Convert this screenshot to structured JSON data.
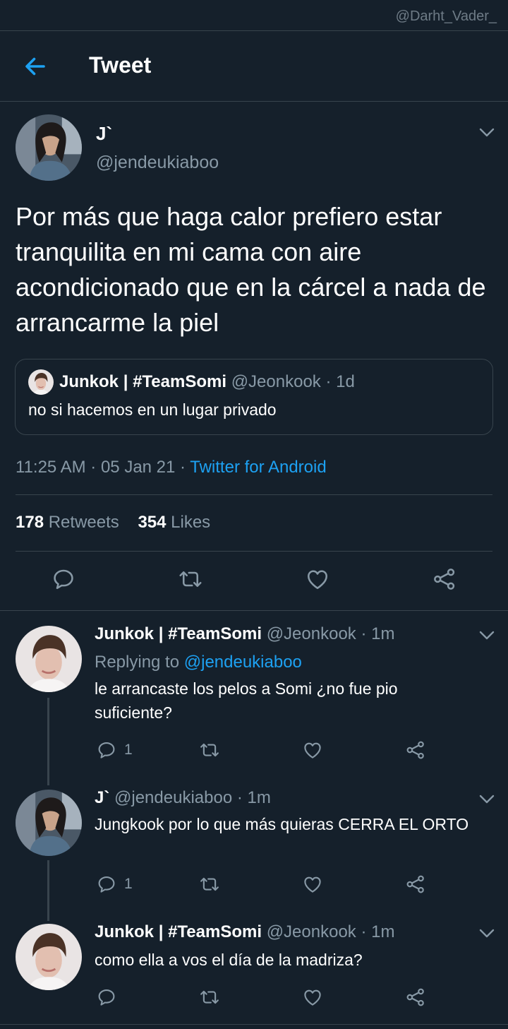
{
  "watermark": "@Darht_Vader_",
  "header": {
    "title": "Tweet"
  },
  "tweet": {
    "name": "J`",
    "handle": "@jendeukiaboo",
    "text": "Por más que haga calor prefiero estar tranquilita en mi cama con aire acondicionado que en la cárcel a nada de arrancarme la piel",
    "quote": {
      "name": "Junkok | #TeamSomi",
      "handle": "@Jeonkook",
      "sep": "·",
      "time": "1d",
      "text": "no si hacemos en un lugar privado"
    },
    "time": "11:25 AM · 05 Jan 21 · ",
    "source": "Twitter for Android",
    "retweets": "178",
    "retweets_label": "Retweets",
    "likes": "354",
    "likes_label": "Likes"
  },
  "replies": [
    {
      "name": "Junkok | #TeamSomi",
      "handle": "@Jeonkook",
      "sep": "·",
      "time": "1m",
      "replying_label": "Replying to ",
      "replying_to": "@jendeukiaboo",
      "text": "le arrancaste los pelos a Somi ¿no fue pio suficiente?",
      "reply_count": "1"
    },
    {
      "name": "J`",
      "handle": "@jendeukiaboo",
      "sep": "·",
      "time": "1m",
      "text": "Jungkook por lo que más quieras CERRA EL ORTO",
      "reply_count": "1"
    },
    {
      "name": "Junkok | #TeamSomi",
      "handle": "@Jeonkook",
      "sep": "·",
      "time": "1m",
      "text": "como ella a vos el día de la madriza?"
    }
  ],
  "colors": {
    "background": "#15202b",
    "accent": "#1da1f2",
    "muted": "#8899a6",
    "divider": "#38444d"
  },
  "icons": [
    "back-arrow-icon",
    "chevron-down-icon",
    "reply-icon",
    "retweet-icon",
    "like-icon",
    "share-icon"
  ]
}
